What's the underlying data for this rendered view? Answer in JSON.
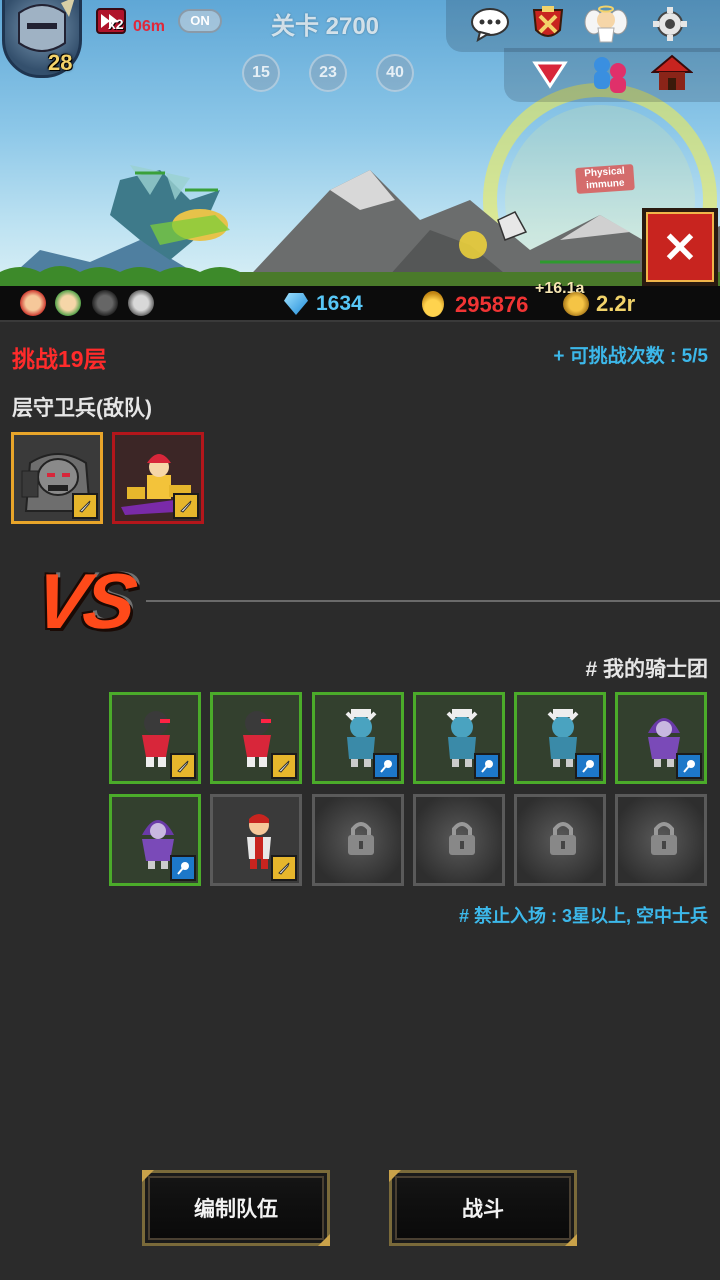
{
  "hud": {
    "hero_level": "28",
    "speed_multiplier": "x2",
    "speed_time": "06m",
    "auto_toggle": "ON",
    "stage_title": "关卡 2700",
    "stage_markers": [
      "15",
      "23",
      "40"
    ],
    "combat_tag": "Physical immune"
  },
  "resources": {
    "gems": "1634",
    "gold": "295876",
    "gold_bonus": "+16.1a",
    "rate": "2.2r"
  },
  "challenge": {
    "title": "挑战19层",
    "attempts": "+ 可挑战次数 : 5/5",
    "enemy_label": "层守卫兵(敌队)",
    "vs": "VS",
    "my_team_label": "# 我的骑士团",
    "restriction": "# 禁止入场 : 3星以上, 空中士兵"
  },
  "buttons": {
    "edit_team": "编制队伍",
    "fight": "战斗"
  },
  "colors": {
    "accent_red": "#ff2b2b",
    "accent_blue": "#3cb8ea",
    "gold_text": "#f03434",
    "frame_gold": "#e8a52a",
    "frame_green": "#4bab2a"
  }
}
